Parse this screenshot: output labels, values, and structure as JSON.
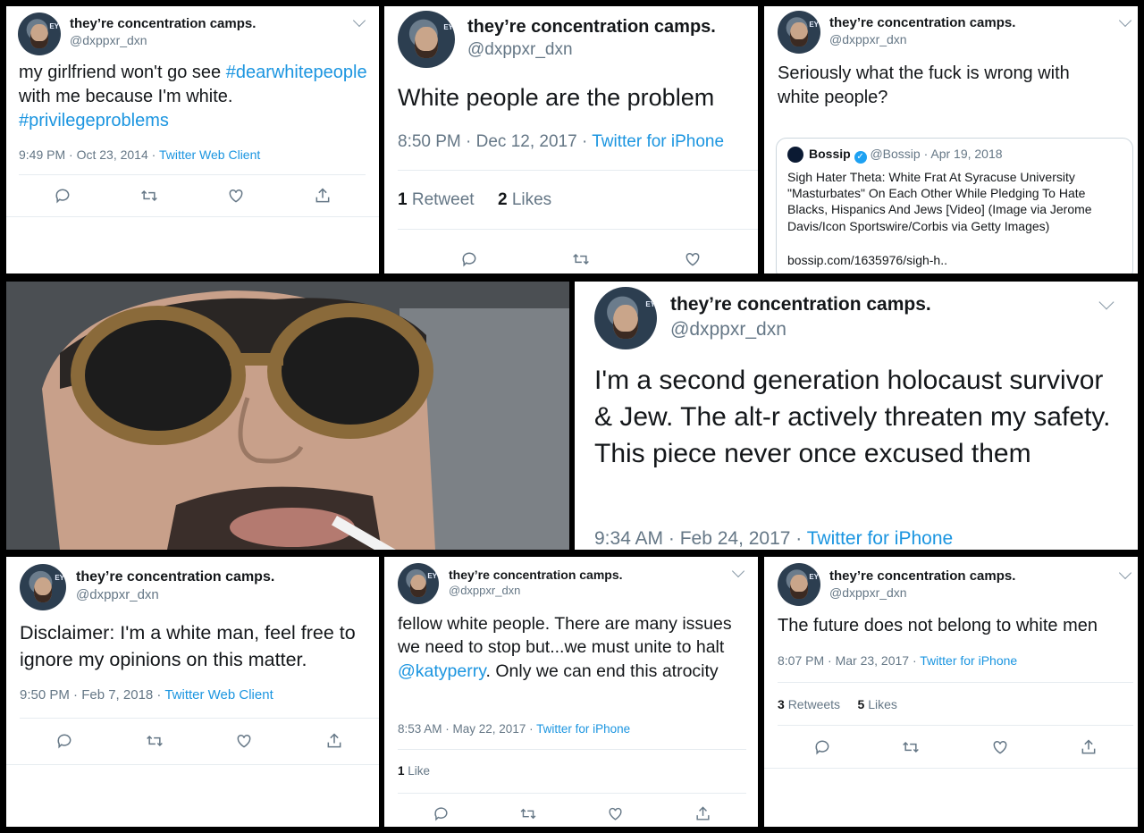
{
  "account": {
    "name": "they’re concentration camps.",
    "handle": "@dxppxr_dxn",
    "avatar_badge": "EY"
  },
  "tweets": [
    {
      "text_parts": [
        "my girlfriend won't go see ",
        "#dearwhitepeople",
        " with me because I'm white. ",
        "#privilegeproblems"
      ],
      "time": "9:49 PM · Oct 23, 2014 · ",
      "source": "Twitter Web Client"
    },
    {
      "text": "White people are the problem",
      "time": "8:50 PM · Dec 12, 2017 · ",
      "source": "Twitter for iPhone",
      "retweets": "1",
      "retweets_label": "Retweet",
      "likes": "2",
      "likes_label": "Likes"
    },
    {
      "text": "Seriously what the fuck is wrong with white people?",
      "quote": {
        "name": "Bossip",
        "handle": "@Bossip · Apr 19, 2018",
        "text": "Sigh Hater Theta: White Frat At Syracuse University \"Masturbates\" On Each Other While Pledging To Hate Blacks, Hispanics And Jews [Video] (Image via Jerome Davis/Icon Sportswire/Corbis via Getty Images)",
        "link": "bossip.com/1635976/sigh-h.."
      }
    },
    {
      "text": "I'm a second generation holocaust survivor & Jew. The alt-r actively threaten my safety. This piece never once excused them",
      "time": "9:34 AM · Feb 24, 2017 · ",
      "source": "Twitter for iPhone"
    },
    {
      "text": "Disclaimer: I'm a white man, feel free to ignore my opinions on this matter.",
      "time": "9:50 PM · Feb 7, 2018 · ",
      "source": "Twitter Web Client"
    },
    {
      "text_parts": [
        "fellow white people. There are many issues we need to stop but...we must unite to halt ",
        "@katyperry",
        ". Only we can end this atrocity"
      ],
      "time": "8:53 AM · May 22, 2017 · ",
      "source": "Twitter for iPhone",
      "likes": "1",
      "likes_label": "Like"
    },
    {
      "text": "The future does not belong to white men",
      "time": "8:07 PM · Mar 23, 2017 · ",
      "source": "Twitter for iPhone",
      "retweets": "3",
      "retweets_label": "Retweets",
      "likes": "5",
      "likes_label": "Likes"
    }
  ],
  "colors": {
    "link": "#1b95e0",
    "meta": "#657786",
    "text": "#14171a",
    "border": "#e6ecf0",
    "verified": "#1da1f2"
  }
}
